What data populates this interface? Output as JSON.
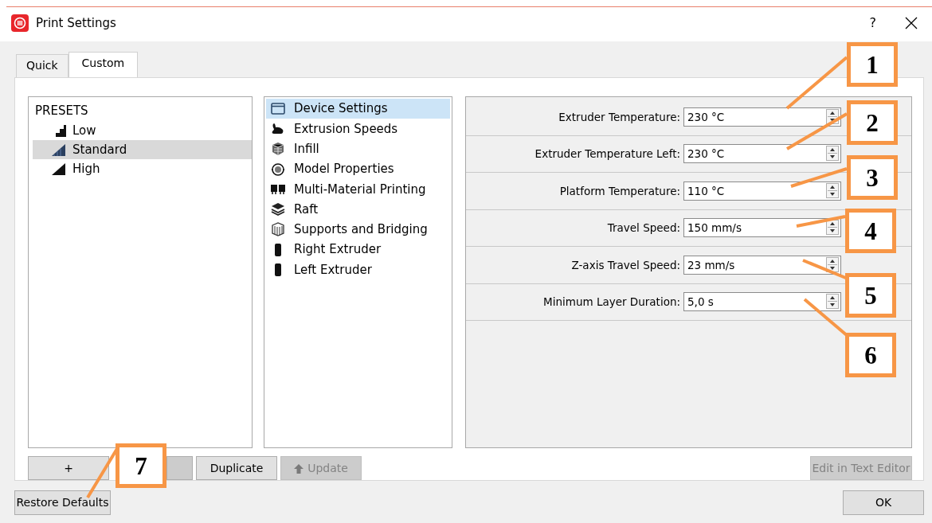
{
  "window": {
    "title": "Print Settings",
    "help": "?"
  },
  "tabs": [
    {
      "label": "Quick",
      "selected": false
    },
    {
      "label": "Custom",
      "selected": true
    }
  ],
  "presets": {
    "heading": "PRESETS",
    "items": [
      {
        "label": "Low",
        "selected": false
      },
      {
        "label": "Standard",
        "selected": true
      },
      {
        "label": "High",
        "selected": false
      }
    ]
  },
  "categories": [
    {
      "label": "Device Settings",
      "selected": true
    },
    {
      "label": "Extrusion Speeds",
      "selected": false
    },
    {
      "label": "Infill",
      "selected": false
    },
    {
      "label": "Model Properties",
      "selected": false
    },
    {
      "label": "Multi-Material Printing",
      "selected": false
    },
    {
      "label": "Raft",
      "selected": false
    },
    {
      "label": "Supports and Bridging",
      "selected": false
    },
    {
      "label": "Right Extruder",
      "selected": false
    },
    {
      "label": "Left Extruder",
      "selected": false
    }
  ],
  "settings": [
    {
      "label": "Extruder Temperature:",
      "value": "230 °C"
    },
    {
      "label": "Extruder Temperature Left:",
      "value": "230 °C"
    },
    {
      "label": "Platform Temperature:",
      "value": "110 °C"
    },
    {
      "label": "Travel Speed:",
      "value": "150 mm/s"
    },
    {
      "label": "Z-axis Travel Speed:",
      "value": "23 mm/s"
    },
    {
      "label": "Minimum Layer Duration:",
      "value": "5,0 s"
    }
  ],
  "preset_buttons": [
    {
      "label": "+",
      "disabled": false,
      "kind": "plain"
    },
    {
      "label": "Duplicate",
      "disabled": false,
      "kind": "plain"
    },
    {
      "label": "Update",
      "disabled": true,
      "kind": "arrow"
    }
  ],
  "editor_button": {
    "label": "Edit in Text Editor",
    "disabled": true
  },
  "restore_button": {
    "label": "Restore Defaults"
  },
  "ok_button": {
    "label": "OK"
  },
  "callouts": [
    {
      "label": "1"
    },
    {
      "label": "2"
    },
    {
      "label": "3"
    },
    {
      "label": "4"
    },
    {
      "label": "5"
    },
    {
      "label": "6"
    },
    {
      "label": "7"
    }
  ]
}
